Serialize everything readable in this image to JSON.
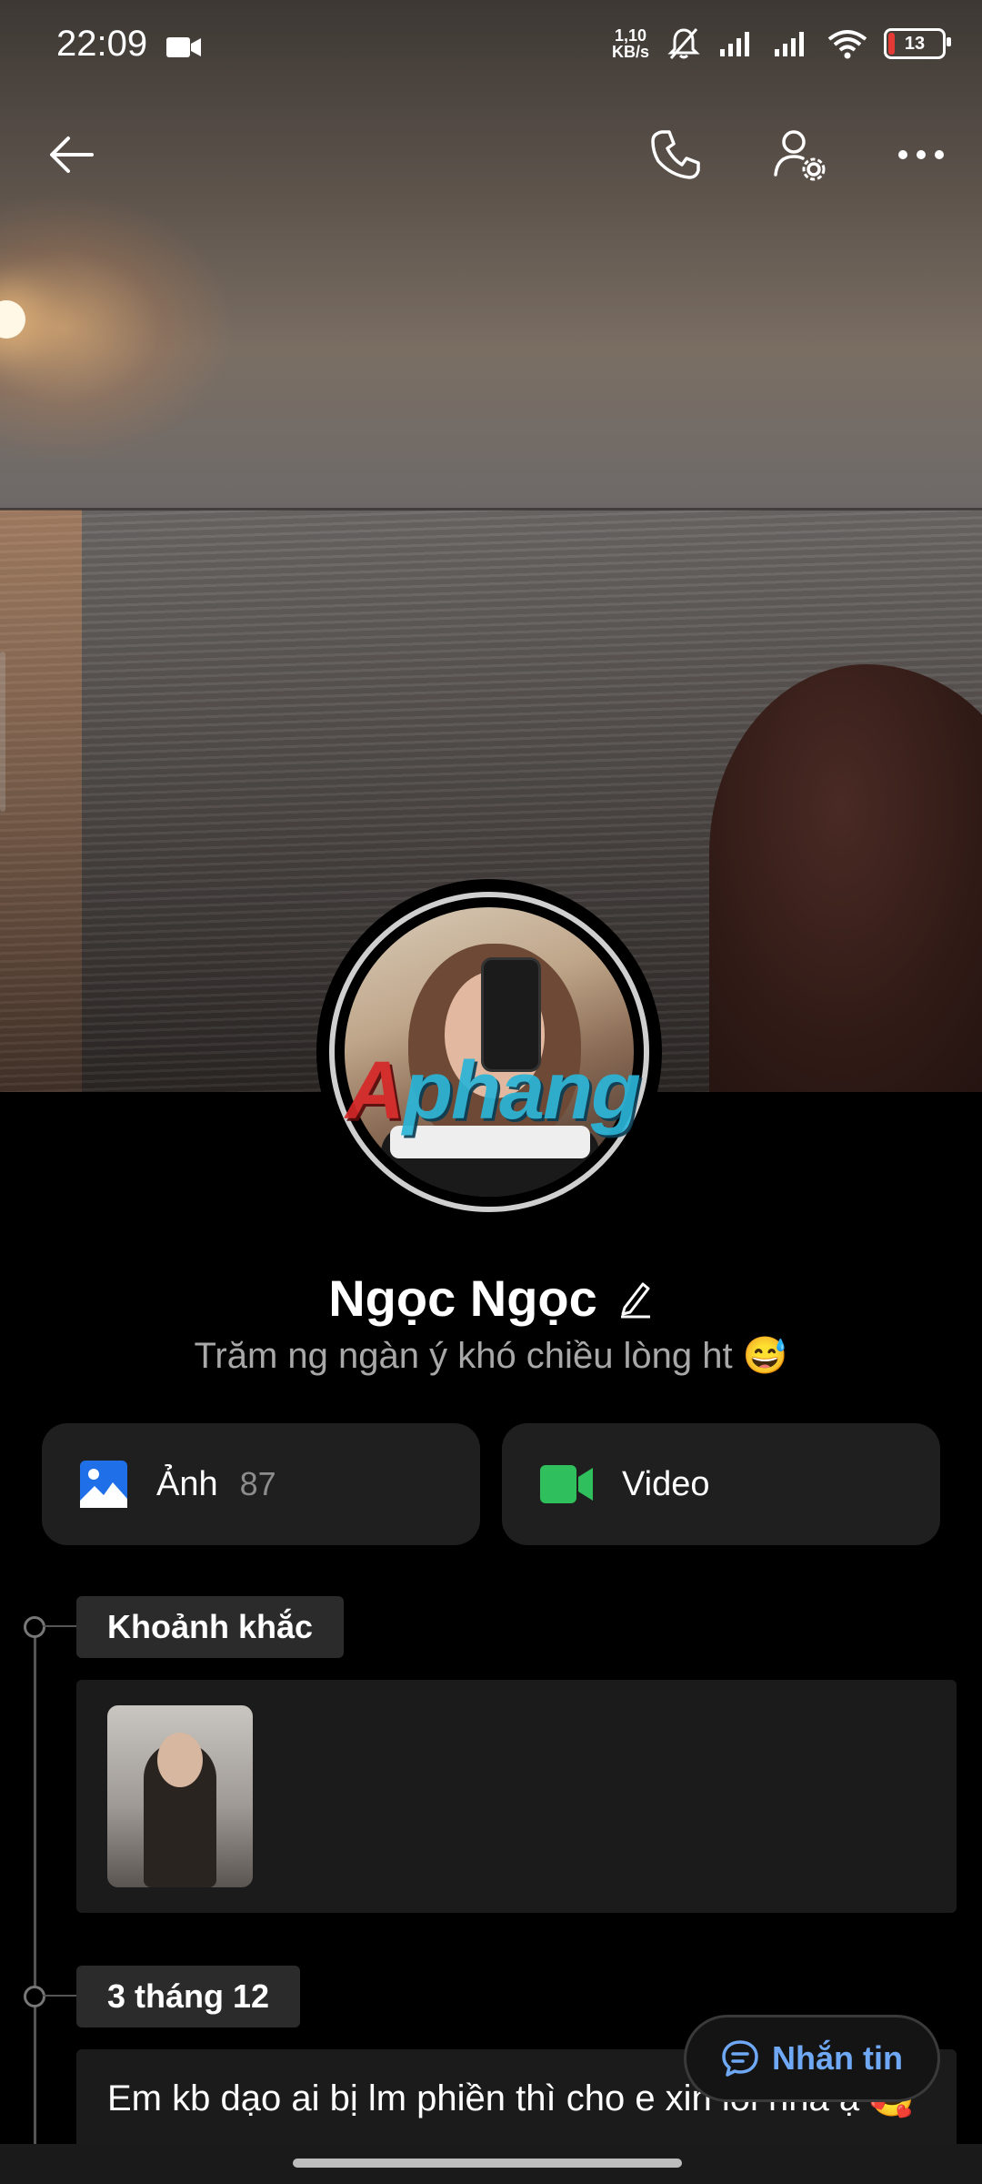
{
  "status_bar": {
    "time": "22:09",
    "net_speed_value": "1,10",
    "net_speed_unit": "KB/s",
    "battery": "13",
    "battery_level": 0.13
  },
  "header": {
    "icons": [
      "back-arrow-icon",
      "phone-icon",
      "user-settings-icon",
      "more-icon"
    ]
  },
  "profile": {
    "name": "Ngọc Ngọc",
    "bio": "Trăm ng ngàn ý khó chiều lòng ht 😅",
    "watermark": "Aphang"
  },
  "media": {
    "photos_label": "Ảnh",
    "photos_count": "87",
    "videos_label": "Video"
  },
  "timeline": {
    "moments_label": "Khoảnh khắc",
    "date_label": "3 tháng 12",
    "post_text": "Em kb dạo ai bị lm phiền thì cho e xin lỗi nha ạ 🥰"
  },
  "message_button": {
    "label": "Nhắn tin"
  },
  "colors": {
    "background": "#000000",
    "card": "#1f1f1f",
    "accent_blue": "#6fa8f5",
    "photo_icon": "#1e6fe8",
    "video_icon": "#2fbf5c"
  }
}
